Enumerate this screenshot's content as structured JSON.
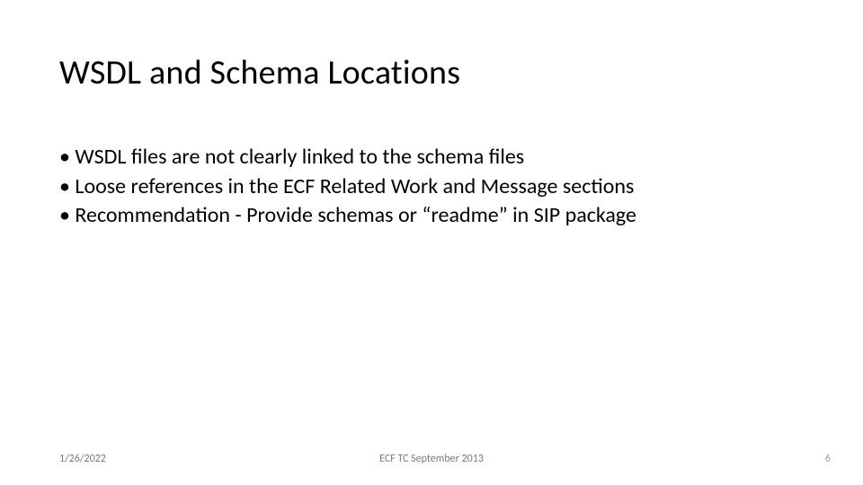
{
  "slide": {
    "title": "WSDL and Schema Locations",
    "bullets": [
      "WSDL files are not clearly linked to the schema files",
      "Loose references in the ECF Related Work and Message sections",
      "Recommendation - Provide schemas or “readme” in SIP package"
    ],
    "footer": {
      "date": "1/26/2022",
      "center": "ECF TC September 2013",
      "page": "6"
    }
  }
}
